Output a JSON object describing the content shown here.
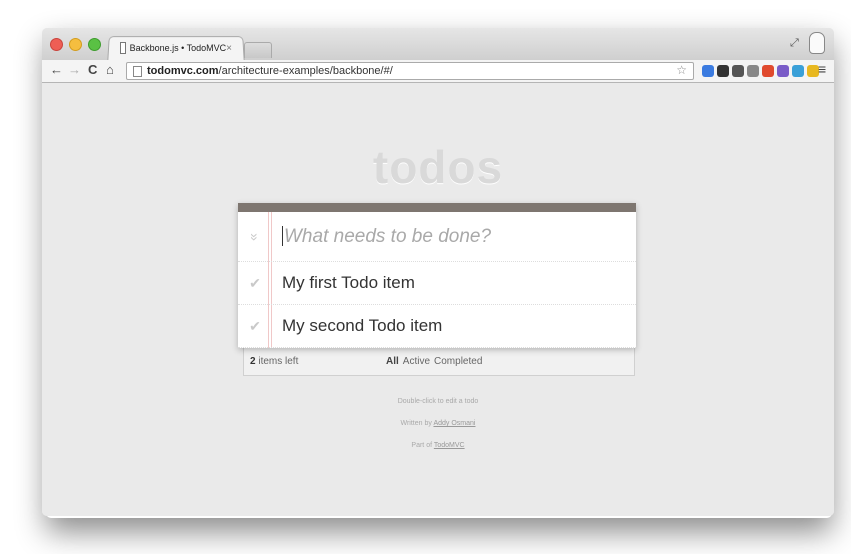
{
  "browser": {
    "tab_title": "Backbone.js • TodoMVC",
    "tab_close": "×",
    "url_host": "todomvc.com",
    "url_path": "/architecture-examples/backbone/#/",
    "nav_back": "←",
    "nav_forward": "→",
    "nav_reload": "C",
    "nav_home": "⌂",
    "bookmark_star": "☆",
    "menu": "≡",
    "fullscreen": "⤢",
    "extension_colors": [
      "#3b7be0",
      "#333333",
      "#555555",
      "#888888",
      "#e04a2e",
      "#7a5cc8",
      "#3aa0d8",
      "#e8b820"
    ]
  },
  "app": {
    "title": "todos",
    "new_todo_placeholder": "What needs to be done?",
    "toggle_all_icon": "»",
    "check_icon": "✔",
    "items": [
      {
        "label": "My first Todo item",
        "completed": false
      },
      {
        "label": "My second Todo item",
        "completed": false
      }
    ],
    "footer": {
      "count": "2",
      "count_suffix": " items left",
      "filters": [
        "All",
        "Active",
        "Completed"
      ]
    },
    "info": {
      "hint": "Double-click to edit a todo",
      "written_by_prefix": "Written by ",
      "author": "Addy Osmani",
      "part_of_prefix": "Part of ",
      "part_of_link": "TodoMVC"
    }
  }
}
